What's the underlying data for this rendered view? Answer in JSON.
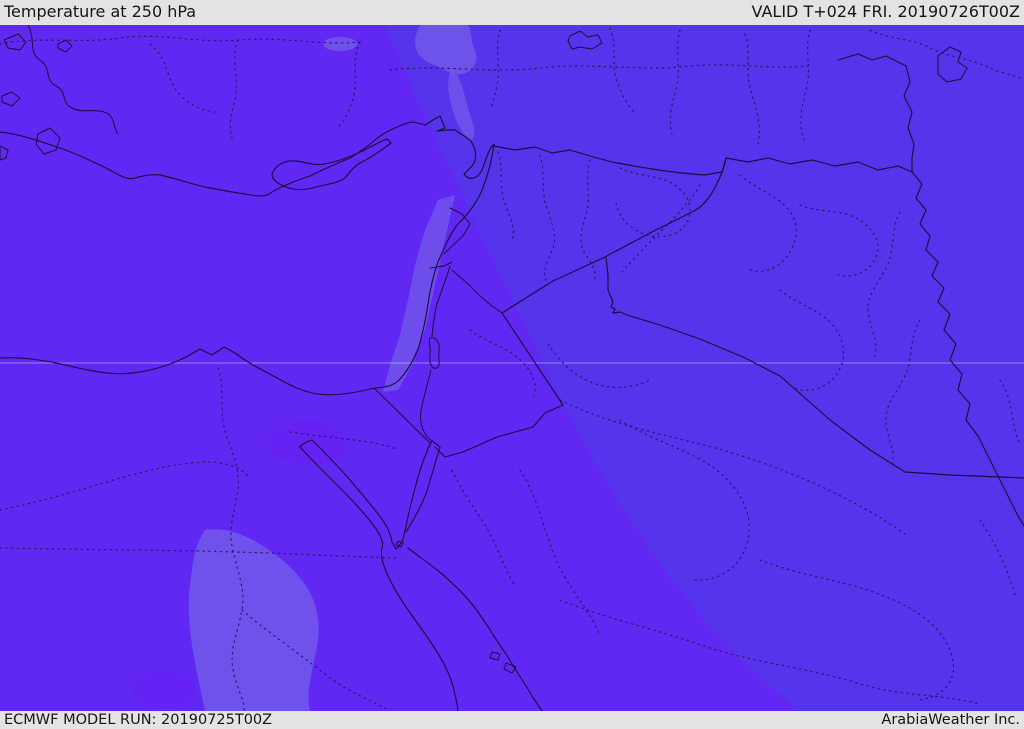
{
  "header": {
    "title": "Temperature at 250 hPa",
    "validity": "VALID T+024 FRI. 20190726T00Z"
  },
  "footer": {
    "model_run": "ECMWF MODEL RUN: 20190725T00Z",
    "credit": "ArabiaWeather Inc."
  },
  "map": {
    "parameter": "Temperature",
    "level": "250 hPa",
    "model": "ECMWF",
    "colors": {
      "bar_background": "#e3e3e3",
      "bar_text": "#151515",
      "field_base_violet": "#6028f2",
      "field_east_blue_violet": "#5634eb",
      "field_light_periwinkle": "#7157eb",
      "field_bright_violet": "#6c1cf7",
      "boundary_line": "#190f3e",
      "gridline": "#cfc8f7"
    },
    "regions_depicted": [
      "Turkey",
      "Cyprus",
      "Syria",
      "Lebanon",
      "Israel",
      "Jordan",
      "Iraq",
      "Iran",
      "Saudi Arabia",
      "Egypt"
    ],
    "features_depicted": [
      "Mediterranean coastline",
      "Nile Delta",
      "Sinai Peninsula",
      "Gulf of Suez",
      "Gulf of Aqaba",
      "Red Sea",
      "Lake Van",
      "Lake Tuz",
      "Dead Sea"
    ]
  }
}
